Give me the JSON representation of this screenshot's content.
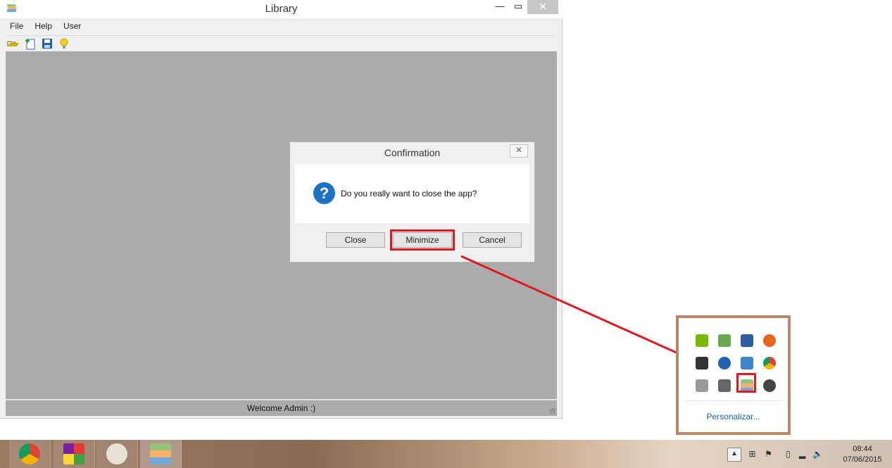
{
  "window": {
    "title": "Library",
    "controls": {
      "minimize": "—",
      "maximize": "▭",
      "close": "✕"
    },
    "menu": [
      "File",
      "Help",
      "User"
    ],
    "toolbar_icons": [
      "open-folder-icon",
      "new-document-icon",
      "save-disk-icon",
      "lightbulb-icon"
    ],
    "status_text": "Welcome Admin :)"
  },
  "dialog": {
    "title": "Confirmation",
    "close_glyph": "✕",
    "icon": "question-icon",
    "icon_glyph": "?",
    "message": "Do you really want to close the app?",
    "buttons": {
      "close": "Close",
      "minimize": "Minimize",
      "cancel": "Cancel"
    }
  },
  "tray_popup": {
    "icons": [
      "nvidia-icon",
      "battery-check-icon",
      "avast-icon",
      "office-icon",
      "usb-icon",
      "bluetooth-icon",
      "network-icon",
      "chrome-icon",
      "download-icon",
      "cart-icon",
      "library-app-icon",
      "creative-cloud-icon"
    ],
    "customize_label": "Personalizar..."
  },
  "taskbar": {
    "apps": [
      "chrome-icon",
      "windows-app-icon",
      "paint-icon",
      "library-app-icon"
    ],
    "chevron": "▲",
    "time": "08:44",
    "date": "07/06/2015"
  },
  "colors": {
    "highlight": "#e01820",
    "workspace": "#ababab",
    "link": "#1d5fa8"
  }
}
